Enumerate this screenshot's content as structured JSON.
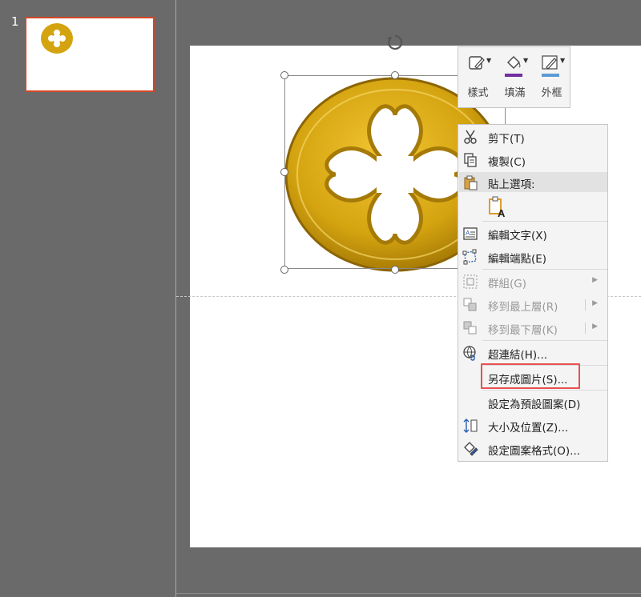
{
  "slides_pane": {
    "slide_number": "1"
  },
  "mini_toolbar": {
    "style_label": "樣式",
    "fill_label": "填滿",
    "outline_label": "外框",
    "colors": {
      "fill": "#7030a0",
      "outline": "#5b9bd5"
    }
  },
  "context_menu": {
    "items": [
      {
        "label": "剪下(T)",
        "icon": "scissors-icon",
        "enabled": true
      },
      {
        "label": "複製(C)",
        "icon": "copy-icon",
        "enabled": true
      },
      {
        "label": "貼上選項:",
        "icon": "paste-icon",
        "enabled": true
      },
      {
        "label": "編輯文字(X)",
        "icon": "edit-text-icon",
        "enabled": true
      },
      {
        "label": "編輯端點(E)",
        "icon": "edit-points-icon",
        "enabled": true
      },
      {
        "label": "群組(G)",
        "icon": "group-icon",
        "enabled": false
      },
      {
        "label": "移到最上層(R)",
        "icon": "bring-front-icon",
        "enabled": false
      },
      {
        "label": "移到最下層(K)",
        "icon": "send-back-icon",
        "enabled": false
      },
      {
        "label": "超連結(H)...",
        "icon": "hyperlink-icon",
        "enabled": true
      },
      {
        "label": "另存成圖片(S)...",
        "icon": "",
        "enabled": true
      },
      {
        "label": "設定為預設圖案(D)",
        "icon": "",
        "enabled": true
      },
      {
        "label": "大小及位置(Z)...",
        "icon": "size-position-icon",
        "enabled": true
      },
      {
        "label": "設定圖案格式(O)...",
        "icon": "format-shape-icon",
        "enabled": true
      }
    ],
    "highlighted_item": "另存成圖片(S)..."
  },
  "colors": {
    "shape_gold": "#d4a310",
    "highlight_red": "#e8504f",
    "thumb_border": "#d24726"
  }
}
